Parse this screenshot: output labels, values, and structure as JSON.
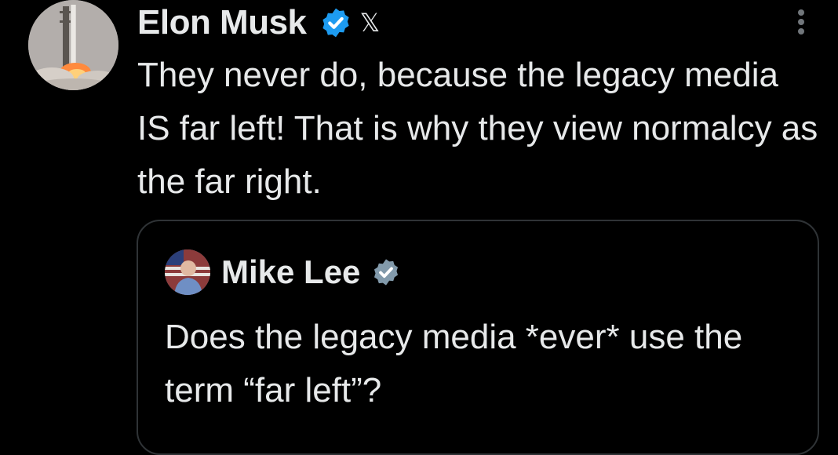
{
  "tweet": {
    "author_name": "Elon Musk",
    "verified_icon": "verified-badge-icon",
    "affiliation_badge": "𝕏",
    "text": "They never do, because the legacy media IS far left! That is why they view normalcy as the far right.",
    "more_icon": "more-options-icon"
  },
  "quoted_tweet": {
    "author_name": "Mike Lee",
    "verified_icon": "verified-badge-icon",
    "text": "Does the legacy media *ever* use the term “far left”?"
  },
  "colors": {
    "background": "#000000",
    "text": "#e7e9ea",
    "verified_blue": "#1d9bf0",
    "verified_gray": "#829aab",
    "border": "#2f3336",
    "muted": "#71767b"
  }
}
